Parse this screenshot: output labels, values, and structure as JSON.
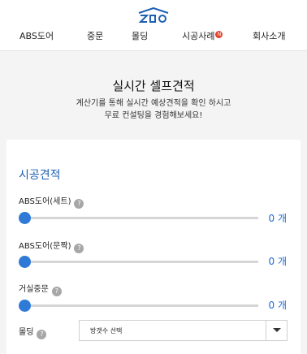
{
  "header": {
    "logo_icon": "zio-house-logo-icon",
    "brand_color": "#1d5fb4",
    "nav": [
      {
        "label": "ABS도어"
      },
      {
        "label": "중문"
      },
      {
        "label": "몰딩"
      },
      {
        "label": "시공사례",
        "badge": "N"
      },
      {
        "label": "회사소개"
      }
    ]
  },
  "hero": {
    "title": "실시간 셀프견적",
    "desc_line1": "계산기를 통해 실시간 예상견적을 확인 하시고",
    "desc_line2": "무료 컨설팅을 경험해보세요!"
  },
  "estimate": {
    "title": "시공견적",
    "help_icon": "question-icon",
    "sliders": [
      {
        "label": "ABS도어(세트)",
        "value": 0,
        "fraction": 0,
        "unit": "개"
      },
      {
        "label": "ABS도어(문짝)",
        "value": 0,
        "fraction": 0,
        "unit": "개"
      },
      {
        "label": "거실중문",
        "value": 0,
        "fraction": 0,
        "unit": "개"
      }
    ],
    "molding": {
      "label": "몰딩",
      "select_value": "방갯수 선택"
    },
    "accent_color": "#2f7ad6"
  }
}
